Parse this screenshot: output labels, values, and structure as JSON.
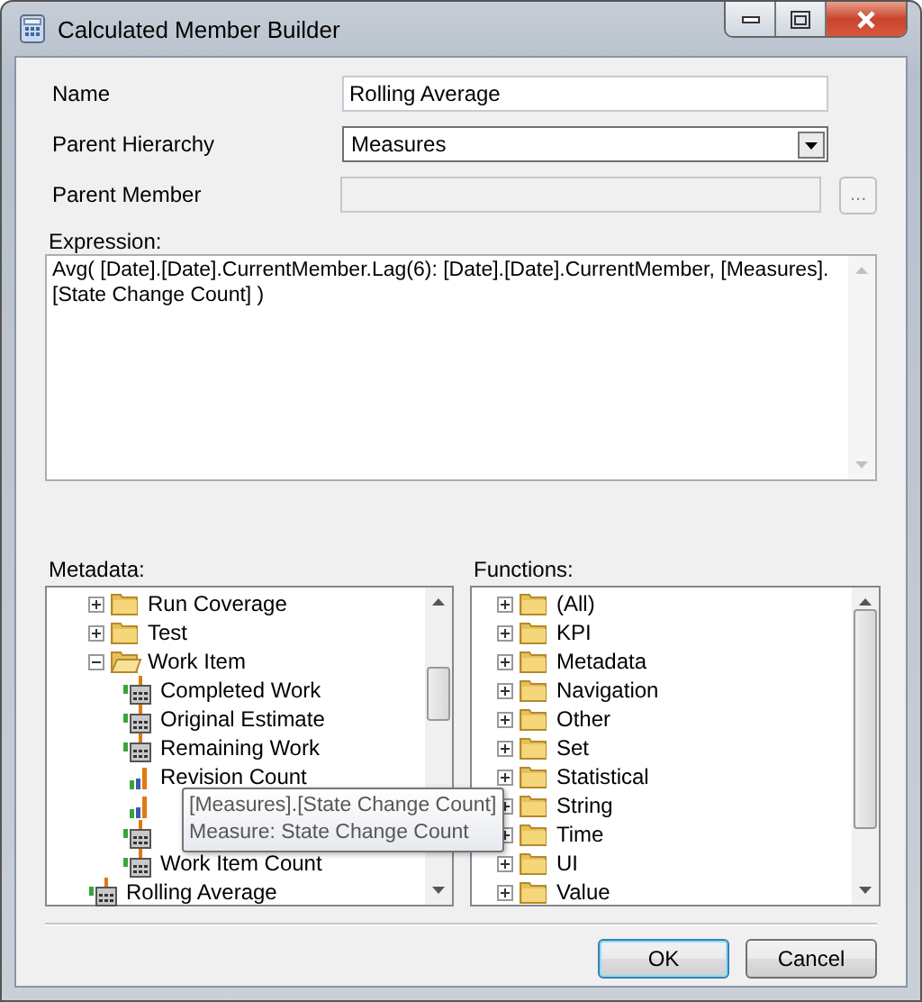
{
  "window": {
    "title": "Calculated Member Builder"
  },
  "fields": [
    {
      "kind": "text",
      "label": "Name",
      "value": "Rolling Average"
    },
    {
      "kind": "dropdown",
      "label": "Parent Hierarchy",
      "value": "Measures"
    },
    {
      "kind": "picker",
      "label": "Parent Member",
      "disabled": true,
      "button": "..."
    }
  ],
  "expression": {
    "label": "Expression:",
    "value": "Avg( [Date].[Date].CurrentMember.Lag(6): [Date].[Date].CurrentMember, [Measures].[State Change Count] )"
  },
  "metadata": {
    "label": "Metadata:",
    "items": [
      {
        "kind": "folder",
        "label": "Run Coverage",
        "expanded": false
      },
      {
        "kind": "folder",
        "label": "Test",
        "expanded": false
      },
      {
        "kind": "folder",
        "label": "Work Item",
        "expanded": true,
        "children": [
          {
            "kind": "sum",
            "label": "Completed Work"
          },
          {
            "kind": "sum",
            "label": "Original Estimate"
          },
          {
            "kind": "sum",
            "label": "Remaining Work"
          },
          {
            "kind": "count",
            "label": "Revision Count"
          },
          {
            "kind": "count"
          },
          {
            "kind": "sum"
          },
          {
            "kind": "sum",
            "label": "Work Item Count"
          }
        ]
      },
      {
        "kind": "sum",
        "label": "Rolling Average"
      }
    ],
    "tooltip": [
      "[Measures].[State Change Count]",
      "Measure: State Change Count"
    ]
  },
  "functions": {
    "label": "Functions:",
    "items": [
      {
        "kind": "folder",
        "label": "(All)",
        "expanded": false
      },
      {
        "kind": "folder",
        "label": "KPI",
        "expanded": false
      },
      {
        "kind": "folder",
        "label": "Metadata",
        "expanded": false
      },
      {
        "kind": "folder",
        "label": "Navigation",
        "expanded": false
      },
      {
        "kind": "folder",
        "label": "Other",
        "expanded": false
      },
      {
        "kind": "folder",
        "label": "Set",
        "expanded": false
      },
      {
        "kind": "folder",
        "label": "Statistical",
        "expanded": false
      },
      {
        "kind": "folder",
        "label": "String",
        "expanded": false
      },
      {
        "kind": "folder",
        "label": "Time",
        "expanded": false
      },
      {
        "kind": "folder",
        "label": "UI",
        "expanded": false
      },
      {
        "kind": "folder",
        "label": "Value",
        "expanded": false
      }
    ]
  },
  "buttons": [
    {
      "label": "OK",
      "default": true
    },
    {
      "label": "Cancel",
      "default": false
    }
  ]
}
